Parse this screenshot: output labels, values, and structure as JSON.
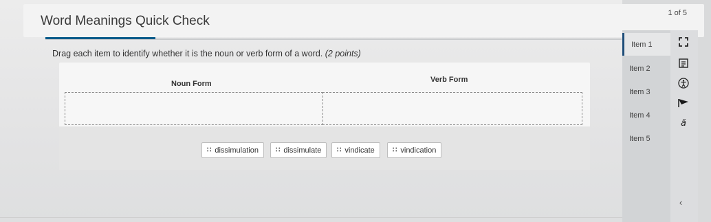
{
  "header": {
    "title": "Word Meanings Quick Check",
    "counter": "1 of 5"
  },
  "question": {
    "prompt": "Drag each item to identify whether it is the noun or verb form of a word.",
    "points": "(2 points)"
  },
  "columns": {
    "noun_label": "Noun Form",
    "verb_label": "Verb Form"
  },
  "word_bank": [
    {
      "label": "dissimulation"
    },
    {
      "label": "dissimulate"
    },
    {
      "label": "vindicate"
    },
    {
      "label": "vindication"
    }
  ],
  "nav": {
    "items": [
      {
        "label": "Item 1",
        "active": true
      },
      {
        "label": "Item 2",
        "active": false
      },
      {
        "label": "Item 3",
        "active": false
      },
      {
        "label": "Item 4",
        "active": false
      },
      {
        "label": "Item 5",
        "active": false
      }
    ]
  },
  "toolbar": {
    "icons": [
      "fullscreen-icon",
      "notepad-icon",
      "accessibility-icon",
      "flag-icon",
      "translate-icon"
    ],
    "flag_color": "#1a1a1a"
  },
  "colors": {
    "accent": "#0a5b8a",
    "active_nav_border": "#1f4e79"
  }
}
